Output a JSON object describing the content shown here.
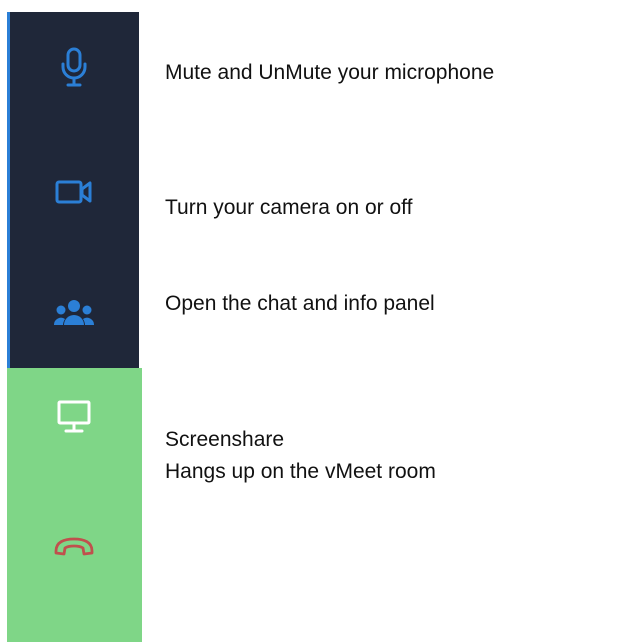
{
  "toolbar": {
    "colors": {
      "dark_panel": "#1f2739",
      "accent_blue": "#2b7fd6",
      "green_panel": "#7fd687",
      "screen_icon": "#ffffff",
      "hangup_icon": "#c0504d"
    },
    "buttons": [
      {
        "icon": "microphone-icon"
      },
      {
        "icon": "camera-icon"
      },
      {
        "icon": "people-icon"
      },
      {
        "icon": "monitor-icon"
      },
      {
        "icon": "phone-hangup-icon"
      }
    ]
  },
  "descriptions": {
    "mic": "Mute and UnMute your microphone",
    "camera": "Turn your camera on or off",
    "people": "Open the chat and info panel",
    "screenshare": "Screenshare",
    "hangup": "Hangs up on the vMeet room"
  }
}
